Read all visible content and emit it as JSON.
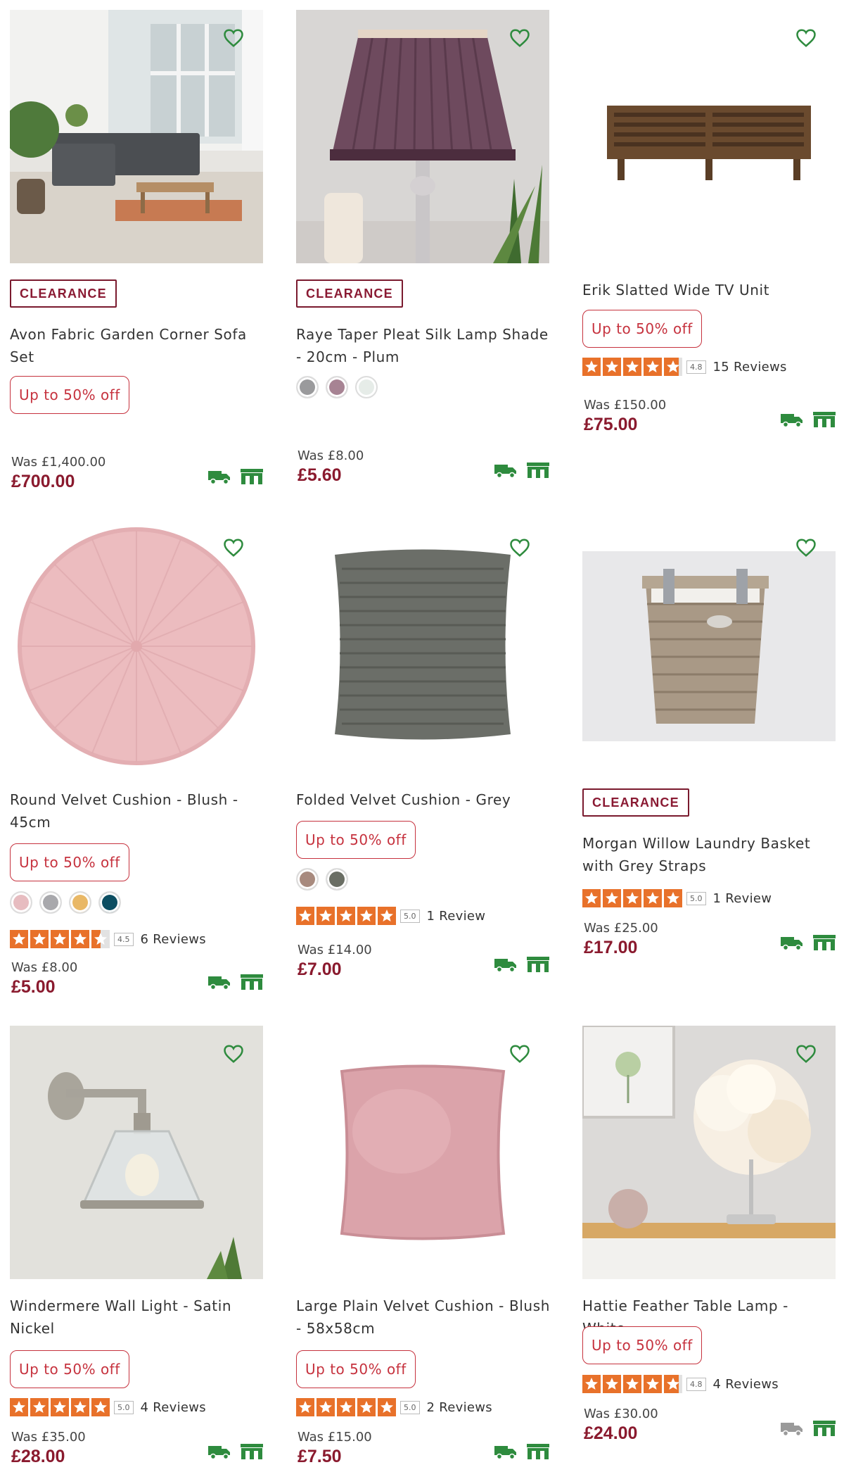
{
  "products": [
    {
      "title": "Avon Fabric Garden Corner Sofa Set",
      "badge": "CLEARANCE",
      "promo": "Up to 50% off",
      "was": "Was £1,400.00",
      "price": "£700.00",
      "image": "garden-sofa-image",
      "delivery_available": true
    },
    {
      "title": "Raye Taper Pleat Silk Lamp Shade - 20cm - Plum",
      "badge": "CLEARANCE",
      "swatches": [
        "#9a9a9c",
        "#a78393",
        "#e6ece8"
      ],
      "was": "Was £8.00",
      "price": "£5.60",
      "image": "lamp-shade-image",
      "delivery_available": true
    },
    {
      "title": "Erik Slatted Wide TV Unit",
      "promo": "Up to 50% off",
      "rating": 4.8,
      "rating_label": "4.8",
      "reviews": "15 Reviews",
      "was": "Was £150.00",
      "price": "£75.00",
      "image": "tv-unit-image",
      "delivery_available": true
    },
    {
      "title": "Round Velvet Cushion - Blush - 45cm",
      "promo": "Up to 50% off",
      "swatches": [
        "#e7bcc0",
        "#a8a8ac",
        "#e9b866",
        "#0c4e62"
      ],
      "rating": 4.5,
      "rating_label": "4.5",
      "reviews": "6 Reviews",
      "was": "Was £8.00",
      "price": "£5.00",
      "image": "round-cushion-image",
      "delivery_available": true
    },
    {
      "title": "Folded Velvet Cushion - Grey",
      "promo": "Up to 50% off",
      "swatches": [
        "#a88a7e",
        "#6a6e64"
      ],
      "rating": 5.0,
      "rating_label": "5.0",
      "reviews": "1 Review",
      "was": "Was £14.00",
      "price": "£7.00",
      "image": "grey-cushion-image",
      "delivery_available": true
    },
    {
      "title": "Morgan Willow Laundry Basket with Grey Straps",
      "badge": "CLEARANCE",
      "rating": 5.0,
      "rating_label": "5.0",
      "reviews": "1 Review",
      "was": "Was £25.00",
      "price": "£17.00",
      "image": "laundry-basket-image",
      "delivery_available": true
    },
    {
      "title": "Windermere Wall Light - Satin Nickel",
      "promo": "Up to 50% off",
      "rating": 5.0,
      "rating_label": "5.0",
      "reviews": "4 Reviews",
      "was": "Was £35.00",
      "price": "£28.00",
      "image": "wall-light-image",
      "delivery_available": true
    },
    {
      "title": "Large Plain Velvet Cushion - Blush - 58x58cm",
      "promo": "Up to 50% off",
      "rating": 5.0,
      "rating_label": "5.0",
      "reviews": "2 Reviews",
      "was": "Was £15.00",
      "price": "£7.50",
      "image": "blush-cushion-image",
      "delivery_available": true
    },
    {
      "title": "Hattie Feather Table Lamp - White",
      "promo": "Up to 50% off",
      "rating": 4.8,
      "rating_label": "4.8",
      "reviews": "4 Reviews",
      "was": "Was £30.00",
      "price": "£24.00",
      "image": "feather-lamp-image",
      "delivery_available": false
    }
  ],
  "colors": {
    "brand_green": "#2e8b3e",
    "price": "#8a1a2e",
    "promo": "#c6323e",
    "star": "#e8712a",
    "unavailable": "#9a9a9a"
  }
}
